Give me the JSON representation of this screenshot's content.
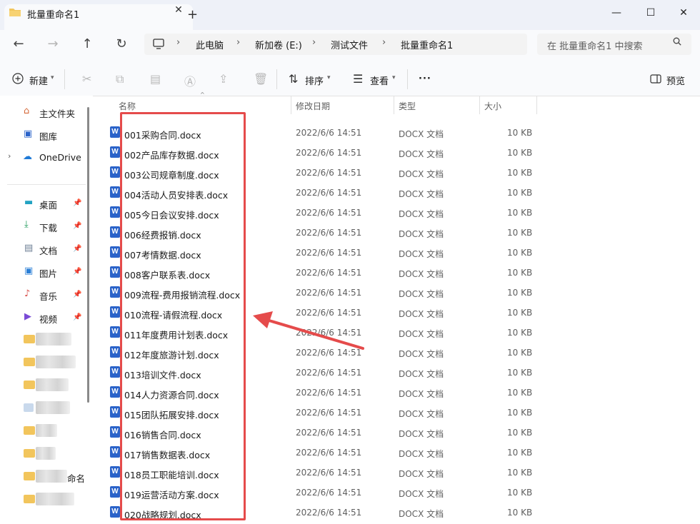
{
  "window": {
    "tab_title": "批量重命名1",
    "tab_close": "✕",
    "new_tab": "+",
    "minimize": "—",
    "maximize": "☐",
    "close": "✕"
  },
  "nav": {
    "back": "←",
    "forward": "→",
    "up": "↑",
    "refresh": "↻"
  },
  "breadcrumb": [
    "此电脑",
    "新加卷 (E:)",
    "测试文件",
    "批量重命名1"
  ],
  "search": {
    "placeholder": "在 批量重命名1 中搜索",
    "icon": "search-icon"
  },
  "toolbar": {
    "new_label": "新建",
    "sort_label": "排序",
    "view_label": "查看",
    "more_label": "···",
    "preview_label": "预览"
  },
  "sidebar": {
    "pinned_top": [
      {
        "label": "主文件夹",
        "icon": "home-icon"
      },
      {
        "label": "图库",
        "icon": "gallery-icon"
      },
      {
        "label": "OneDrive",
        "icon": "cloud-icon"
      }
    ],
    "quick_access": [
      {
        "label": "桌面",
        "icon": "desktop-icon"
      },
      {
        "label": "下载",
        "icon": "download-icon"
      },
      {
        "label": "文档",
        "icon": "document-icon"
      },
      {
        "label": "图片",
        "icon": "picture-icon"
      },
      {
        "label": "音乐",
        "icon": "music-icon"
      },
      {
        "label": "视频",
        "icon": "video-icon"
      }
    ],
    "partial_label": "命名"
  },
  "columns": {
    "name": "名称",
    "modified": "修改日期",
    "type": "类型",
    "size": "大小"
  },
  "files": [
    {
      "name": "001采购合同.docx",
      "modified": "2022/6/6 14:51",
      "type": "DOCX 文档",
      "size": "10 KB"
    },
    {
      "name": "002产品库存数据.docx",
      "modified": "2022/6/6 14:51",
      "type": "DOCX 文档",
      "size": "10 KB"
    },
    {
      "name": "003公司规章制度.docx",
      "modified": "2022/6/6 14:51",
      "type": "DOCX 文档",
      "size": "10 KB"
    },
    {
      "name": "004活动人员安排表.docx",
      "modified": "2022/6/6 14:51",
      "type": "DOCX 文档",
      "size": "10 KB"
    },
    {
      "name": "005今日会议安排.docx",
      "modified": "2022/6/6 14:51",
      "type": "DOCX 文档",
      "size": "10 KB"
    },
    {
      "name": "006经费报销.docx",
      "modified": "2022/6/6 14:51",
      "type": "DOCX 文档",
      "size": "10 KB"
    },
    {
      "name": "007考情数据.docx",
      "modified": "2022/6/6 14:51",
      "type": "DOCX 文档",
      "size": "10 KB"
    },
    {
      "name": "008客户联系表.docx",
      "modified": "2022/6/6 14:51",
      "type": "DOCX 文档",
      "size": "10 KB"
    },
    {
      "name": "009流程-费用报销流程.docx",
      "modified": "2022/6/6 14:51",
      "type": "DOCX 文档",
      "size": "10 KB"
    },
    {
      "name": "010流程-请假流程.docx",
      "modified": "2022/6/6 14:51",
      "type": "DOCX 文档",
      "size": "10 KB"
    },
    {
      "name": "011年度费用计划表.docx",
      "modified": "2022/6/6 14:51",
      "type": "DOCX 文档",
      "size": "10 KB"
    },
    {
      "name": "012年度旅游计划.docx",
      "modified": "2022/6/6 14:51",
      "type": "DOCX 文档",
      "size": "10 KB"
    },
    {
      "name": "013培训文件.docx",
      "modified": "2022/6/6 14:51",
      "type": "DOCX 文档",
      "size": "10 KB"
    },
    {
      "name": "014人力资源合同.docx",
      "modified": "2022/6/6 14:51",
      "type": "DOCX 文档",
      "size": "10 KB"
    },
    {
      "name": "015团队拓展安排.docx",
      "modified": "2022/6/6 14:51",
      "type": "DOCX 文档",
      "size": "10 KB"
    },
    {
      "name": "016销售合同.docx",
      "modified": "2022/6/6 14:51",
      "type": "DOCX 文档",
      "size": "10 KB"
    },
    {
      "name": "017销售数据表.docx",
      "modified": "2022/6/6 14:51",
      "type": "DOCX 文档",
      "size": "10 KB"
    },
    {
      "name": "018员工职能培训.docx",
      "modified": "2022/6/6 14:51",
      "type": "DOCX 文档",
      "size": "10 KB"
    },
    {
      "name": "019运营活动方案.docx",
      "modified": "2022/6/6 14:51",
      "type": "DOCX 文档",
      "size": "10 KB"
    },
    {
      "name": "020战略规划.docx",
      "modified": "2022/6/6 14:51",
      "type": "DOCX 文档",
      "size": "10 KB"
    }
  ],
  "colors": {
    "highlight": "#e54b4b",
    "folder": "#f2c55c",
    "word_icon": "#2b63c9"
  }
}
